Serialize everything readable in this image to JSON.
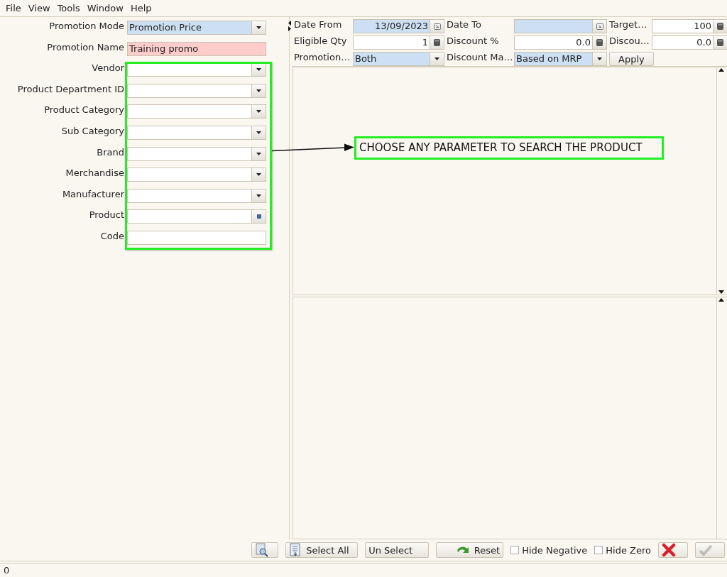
{
  "menu": [
    {
      "label": "File"
    },
    {
      "label": "View"
    },
    {
      "label": "Tools"
    },
    {
      "label": "Window"
    },
    {
      "label": "Help"
    }
  ],
  "form": {
    "fields": [
      {
        "label": "Promotion Mode",
        "kind": "combo",
        "value": "Promotion Price",
        "color": "#cde0f3"
      },
      {
        "label": "Promotion Name",
        "kind": "text",
        "value": "Training promo",
        "color": "#ffcccc"
      },
      {
        "label": "Vendor",
        "kind": "combo",
        "color": "#ffffff"
      },
      {
        "label": "Product Department ID",
        "kind": "combo",
        "color": "#ffffff"
      },
      {
        "label": "Product Category",
        "kind": "combo",
        "color": "#ffffff"
      },
      {
        "label": "Sub Category",
        "kind": "combo",
        "color": "#ffffff"
      },
      {
        "label": "Brand",
        "kind": "combo",
        "color": "#ffffff"
      },
      {
        "label": "Merchandise",
        "kind": "combo",
        "color": "#ffffff"
      },
      {
        "label": "Manufacturer",
        "kind": "combo",
        "color": "#ffffff"
      },
      {
        "label": "Product",
        "kind": "lookup",
        "color": "#ffffff"
      },
      {
        "label": "Code",
        "kind": "text",
        "color": "#ffffff"
      }
    ]
  },
  "filters": [
    {
      "label": "Date From",
      "kind": "date",
      "value": "13/09/2023",
      "color": "#cde0f3"
    },
    {
      "label": "Date To",
      "kind": "date",
      "color": "#cde0f3"
    },
    {
      "label": "Target…",
      "kind": "number",
      "value": "100",
      "color": "#ffffff"
    },
    {
      "label": "Eligible Qty",
      "kind": "number",
      "value": "1",
      "color": "#ffffff"
    },
    {
      "label": "Discount %",
      "kind": "number",
      "value": "0.0",
      "color": "#ffffff"
    },
    {
      "label": "Discou…",
      "kind": "number",
      "value": "0.0",
      "color": "#ffffff"
    },
    {
      "label": "Promotion…",
      "kind": "combo",
      "value": "Both",
      "color": "#cde0f3"
    },
    {
      "label": "Discount Ma…",
      "kind": "combo",
      "value": "Based on MRP",
      "color": "#cde0f3"
    },
    {
      "label": "Apply",
      "kind": "button"
    }
  ],
  "toolbar": [
    {
      "kind": "zoom",
      "disabled": false
    },
    {
      "kind": "select",
      "label": "Select All",
      "disabled": false
    },
    {
      "kind": "plain",
      "label": "Un Select",
      "disabled": false
    },
    {
      "kind": "reset",
      "label": "Reset",
      "disabled": false
    },
    {
      "kind": "checkbox",
      "label": "Hide Negative",
      "checked": false
    },
    {
      "kind": "checkbox",
      "label": "Hide Zero",
      "checked": false
    },
    {
      "kind": "cancel",
      "disabled": false
    },
    {
      "kind": "ok",
      "disabled": true
    }
  ],
  "status_bar": {
    "text": "0"
  },
  "annotation": {
    "text": "CHOOSE ANY PARAMETER TO SEARCH THE PRODUCT"
  }
}
